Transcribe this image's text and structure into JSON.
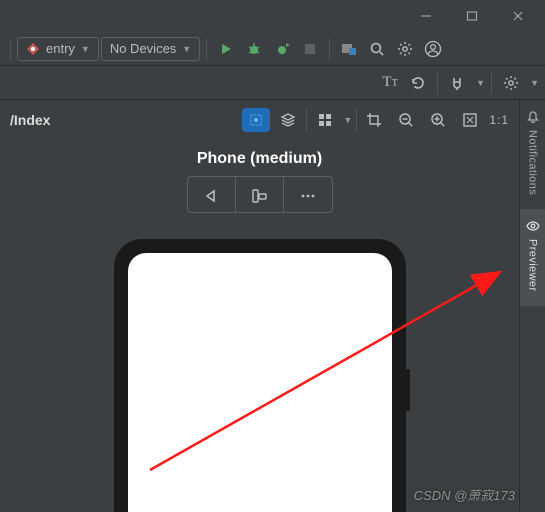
{
  "window": {
    "minimize": "–",
    "maximize": "❐",
    "close": "✕"
  },
  "toolbar": {
    "module_label": "entry",
    "device_label": "No Devices"
  },
  "editor": {
    "tab_label": "/Index"
  },
  "preview": {
    "ratio_label": "1:1",
    "device_name": "Phone (medium)"
  },
  "rail": {
    "notifications": "Notifications",
    "previewer": "Previewer"
  },
  "watermark": "CSDN @萧寂173"
}
